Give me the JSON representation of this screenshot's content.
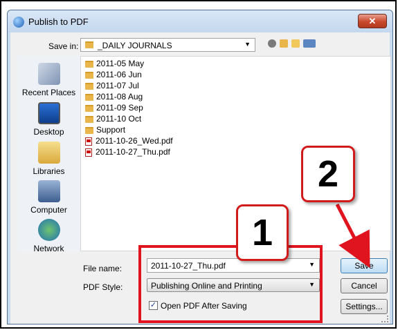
{
  "window": {
    "title": "Publish to PDF",
    "close_glyph": "✕"
  },
  "savein": {
    "label": "Save in:",
    "value": "_DAILY JOURNALS"
  },
  "toolbar_icons": [
    "back-icon",
    "up-folder-icon",
    "new-folder-icon",
    "views-menu-icon"
  ],
  "places": [
    "Recent Places",
    "Desktop",
    "Libraries",
    "Computer",
    "Network"
  ],
  "files": [
    {
      "name": "2011-05 May",
      "type": "folder"
    },
    {
      "name": "2011-06 Jun",
      "type": "folder"
    },
    {
      "name": "2011-07 Jul",
      "type": "folder"
    },
    {
      "name": "2011-08 Aug",
      "type": "folder"
    },
    {
      "name": "2011-09 Sep",
      "type": "folder"
    },
    {
      "name": "2011-10 Oct",
      "type": "folder"
    },
    {
      "name": "Support",
      "type": "folder"
    },
    {
      "name": "2011-10-26_Wed.pdf",
      "type": "pdf"
    },
    {
      "name": "2011-10-27_Thu.pdf",
      "type": "pdf"
    }
  ],
  "form": {
    "filename_label": "File name:",
    "filename_value": "2011-10-27_Thu.pdf",
    "pdfstyle_label": "PDF Style:",
    "pdfstyle_value": "Publishing Online and Printing",
    "open_after_label": "Open PDF After Saving",
    "open_after_checked": true
  },
  "buttons": {
    "save": "Save",
    "cancel": "Cancel",
    "settings": "Settings..."
  },
  "annotations": {
    "callout_1": "1",
    "callout_2": "2",
    "highlight_color": "#e0141e"
  }
}
